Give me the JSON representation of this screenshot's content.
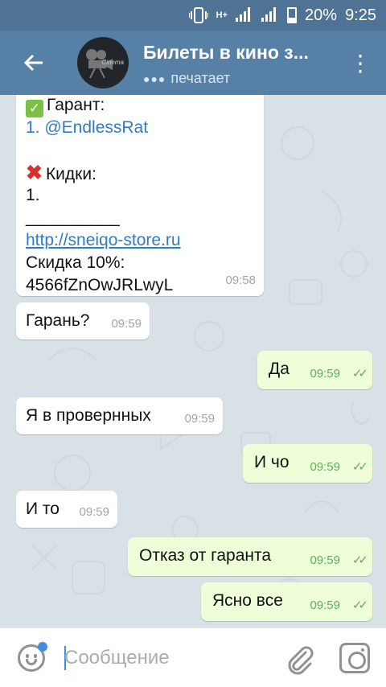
{
  "status_bar": {
    "vibrate_icon": "vibrate-icon",
    "network_type": "H+",
    "battery": "20%",
    "time": "9:25"
  },
  "header": {
    "back_icon": "arrow-left-icon",
    "avatar_label": "Cinema",
    "title": "Билеты в кино з...",
    "status": "печатает",
    "menu_icon": "more-vertical-icon"
  },
  "messages": [
    {
      "direction": "in",
      "lines": [
        "Гарант:",
        "1. @EndlessRat",
        "",
        "Кидки:",
        "1.",
        "__________",
        "http://sneiqo-store.ru",
        "Скидка 10%:",
        "4566fZnOwJRLwyL"
      ],
      "time": "09:58"
    },
    {
      "direction": "in",
      "text": "Гарань?",
      "time": "09:59"
    },
    {
      "direction": "out",
      "text": "Да",
      "time": "09:59"
    },
    {
      "direction": "in",
      "text": "Я в провернных",
      "time": "09:59"
    },
    {
      "direction": "out",
      "text": "И чо",
      "time": "09:59"
    },
    {
      "direction": "in",
      "text": "И то",
      "time": "09:59"
    },
    {
      "direction": "out",
      "text": "Отказ от гаранта",
      "time": "09:59"
    },
    {
      "direction": "out",
      "text": "Ясно все",
      "time": "09:59"
    }
  ],
  "input": {
    "placeholder": "Сообщение",
    "emoji_icon": "smiley-icon",
    "attach_icon": "paperclip-icon",
    "camera_icon": "camera-icon"
  },
  "colors": {
    "header": "#5680a5",
    "status_bar": "#4f7394",
    "outgoing_bubble": "#eefed9",
    "incoming_bubble": "#ffffff",
    "chat_background": "#d8e1e6",
    "link": "#2f7cc3",
    "read_check": "#5fb05d"
  }
}
